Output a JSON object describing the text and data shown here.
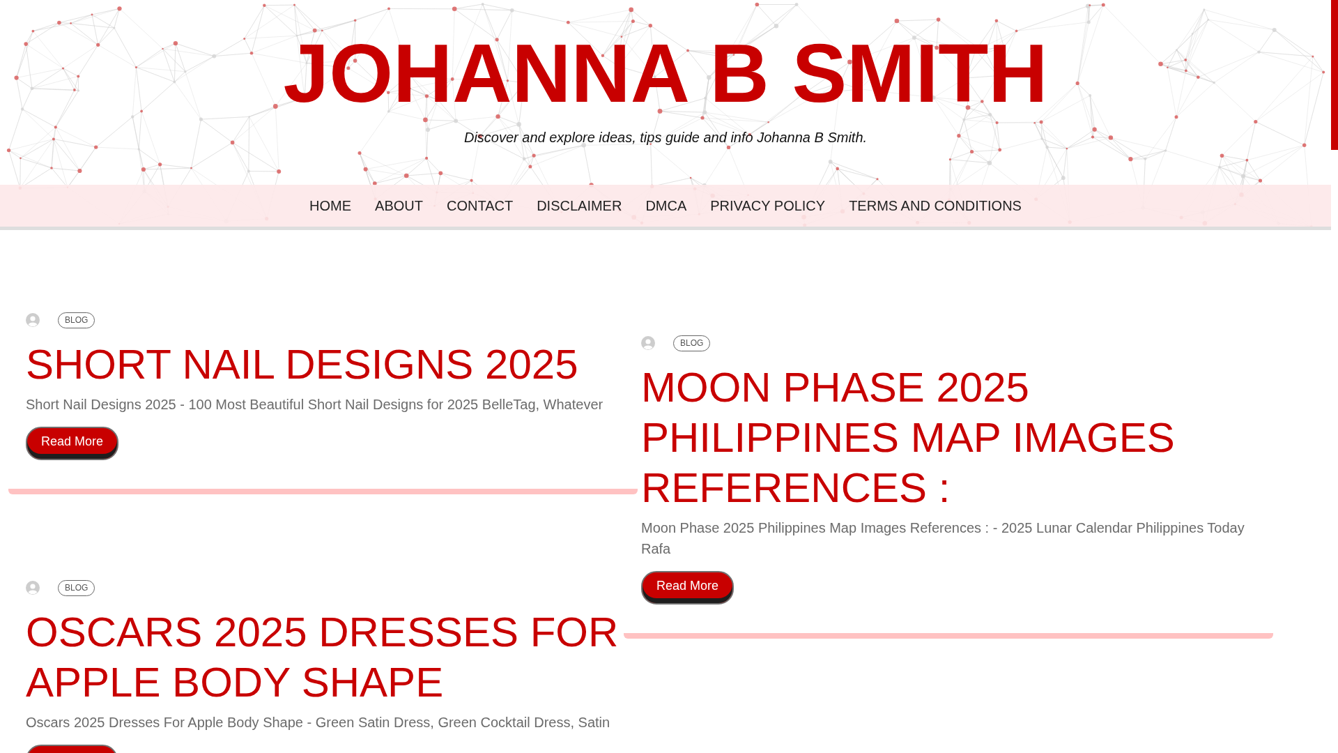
{
  "header": {
    "title": "JOHANNA B SMITH",
    "tagline": "Discover and explore ideas, tips guide and info Johanna B Smith."
  },
  "nav": {
    "items": [
      "HOME",
      "ABOUT",
      "CONTACT",
      "DISCLAIMER",
      "DMCA",
      "PRIVACY POLICY",
      "TERMS AND CONDITIONS"
    ]
  },
  "posts": [
    {
      "category": "BLOG",
      "title": "SHORT NAIL DESIGNS 2025",
      "excerpt": "Short Nail Designs 2025 - 100 Most Beautiful Short Nail Designs for 2025 BelleTag, Whatever",
      "button": "Read More"
    },
    {
      "category": "BLOG",
      "title": "MOON PHASE 2025 PHILIPPINES MAP IMAGES REFERENCES :",
      "excerpt": "Moon Phase 2025 Philippines Map Images References : - 2025 Lunar Calendar Philippines Today Rafa",
      "button": "Read More"
    },
    {
      "category": "BLOG",
      "title": "OSCARS 2025 DRESSES FOR APPLE BODY SHAPE",
      "excerpt": "Oscars 2025 Dresses For Apple Body Shape - Green Satin Dress, Green Cocktail Dress, Satin"
    }
  ]
}
